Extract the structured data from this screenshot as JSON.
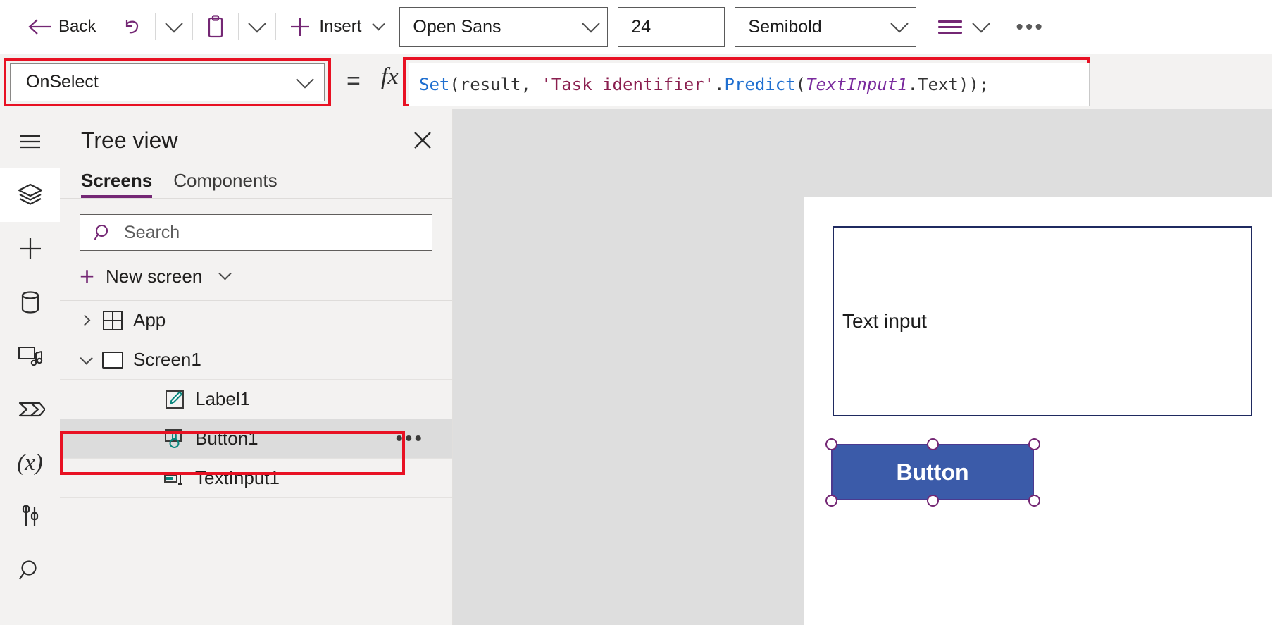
{
  "toolbar": {
    "back_label": "Back",
    "undo_icon": "undo-icon",
    "undo_chevron_icon": "chevron-down-icon",
    "paste_icon": "clipboard-paste-icon",
    "paste_chevron_icon": "chevron-down-icon",
    "insert_plus_icon": "plus-icon",
    "insert_label": "Insert",
    "insert_chevron_icon": "chevron-down-icon",
    "font_name": "Open Sans",
    "font_size": "24",
    "font_weight": "Semibold",
    "align_icon": "align-lines-icon",
    "align_chevron_icon": "chevron-down-icon",
    "overflow_icon": "more-horizontal-icon",
    "accent_color": "#742774"
  },
  "formula_bar": {
    "property": "OnSelect",
    "property_chevron_icon": "chevron-down-icon",
    "equals": "=",
    "fx": "fx",
    "formula_plain": "Set(result, 'Task identifier'.Predict(TextInput1.Text));",
    "tokens": [
      {
        "t": "Set",
        "c": "fn"
      },
      {
        "t": "(result, ",
        "c": "plain"
      },
      {
        "t": "'Task identifier'",
        "c": "str"
      },
      {
        "t": ".",
        "c": "plain"
      },
      {
        "t": "Predict",
        "c": "fn"
      },
      {
        "t": "(",
        "c": "plain"
      },
      {
        "t": "TextInput1",
        "c": "ctrl"
      },
      {
        "t": ".Text));",
        "c": "plain"
      }
    ],
    "highlight_color": "#e81123"
  },
  "rail": {
    "items": [
      {
        "icon": "hamburger-menu-icon",
        "name": "menu",
        "active": false
      },
      {
        "icon": "layers-tree-view-icon",
        "name": "tree-view",
        "active": true
      },
      {
        "icon": "plus-insert-icon",
        "name": "insert",
        "active": false
      },
      {
        "icon": "database-data-icon",
        "name": "data",
        "active": false
      },
      {
        "icon": "media-icon",
        "name": "media",
        "active": false
      },
      {
        "icon": "power-automate-icon",
        "name": "power-automate",
        "active": false
      },
      {
        "icon": "variables-x-icon",
        "name": "variables",
        "active": false
      },
      {
        "icon": "settings-tools-icon",
        "name": "advanced-tools",
        "active": false
      },
      {
        "icon": "search-icon",
        "name": "search",
        "active": false
      }
    ],
    "variables_glyph": "(x)"
  },
  "tree_view": {
    "title": "Tree view",
    "close_icon": "close-icon",
    "tabs": [
      {
        "label": "Screens",
        "active": true
      },
      {
        "label": "Components",
        "active": false
      }
    ],
    "search": {
      "placeholder": "Search",
      "icon": "search-icon"
    },
    "new_screen": {
      "label": "New screen",
      "plus_icon": "plus-icon",
      "chevron_icon": "chevron-down-icon"
    },
    "rows": [
      {
        "label": "App",
        "icon": "app-grid-icon",
        "twisty": "right",
        "indent": false,
        "selected": false,
        "has_menu": false
      },
      {
        "label": "Screen1",
        "icon": "screen-icon",
        "twisty": "down",
        "indent": false,
        "selected": false,
        "has_menu": false
      },
      {
        "label": "Label1",
        "icon": "label-pencil-icon",
        "twisty": "none",
        "indent": true,
        "selected": false,
        "has_menu": false
      },
      {
        "label": "Button1",
        "icon": "button-click-icon",
        "twisty": "none",
        "indent": true,
        "selected": true,
        "has_menu": true,
        "menu_icon": "more-horizontal-icon"
      },
      {
        "label": "TextInput1",
        "icon": "text-input-icon",
        "twisty": "none",
        "indent": true,
        "selected": false,
        "has_menu": false
      }
    ]
  },
  "canvas": {
    "text_input": {
      "value": "Text input",
      "border_color": "#1f2a60"
    },
    "button": {
      "label": "Button",
      "fill": "#3b5ba9",
      "border": "#4b3a8f"
    },
    "selection_handle_color": "#742774"
  }
}
